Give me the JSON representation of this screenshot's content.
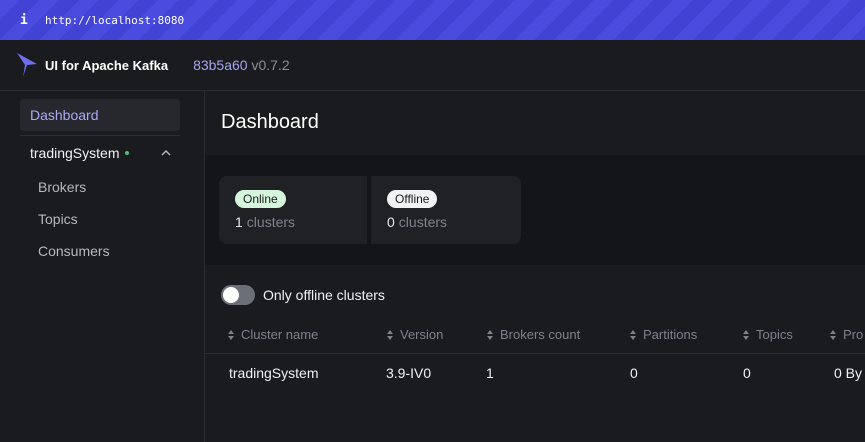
{
  "browser": {
    "url": "http://localhost:8080",
    "info_icon": "i"
  },
  "header": {
    "brand": "UI for Apache Kafka",
    "commit": "83b5a60",
    "version": "v0.7.2",
    "logo_icon": "kafka-logo-icon",
    "accent": "#6e70f0"
  },
  "sidebar": {
    "dashboard": "Dashboard",
    "cluster": {
      "name": "tradingSystem",
      "status_color": "#4cc173"
    },
    "items": [
      {
        "label": "Brokers"
      },
      {
        "label": "Topics"
      },
      {
        "label": "Consumers"
      }
    ]
  },
  "main": {
    "title": "Dashboard",
    "online": {
      "badge": "Online",
      "count": "1",
      "unit": "clusters"
    },
    "offline": {
      "badge": "Offline",
      "count": "0",
      "unit": "clusters"
    },
    "toggle_label": "Only offline clusters",
    "columns": [
      "Cluster name",
      "Version",
      "Brokers count",
      "Partitions",
      "Topics",
      "Pro"
    ],
    "rows": [
      {
        "name": "tradingSystem",
        "version": "3.9-IV0",
        "brokers": "1",
        "partitions": "0",
        "topics": "0",
        "production": "0 By"
      }
    ]
  }
}
